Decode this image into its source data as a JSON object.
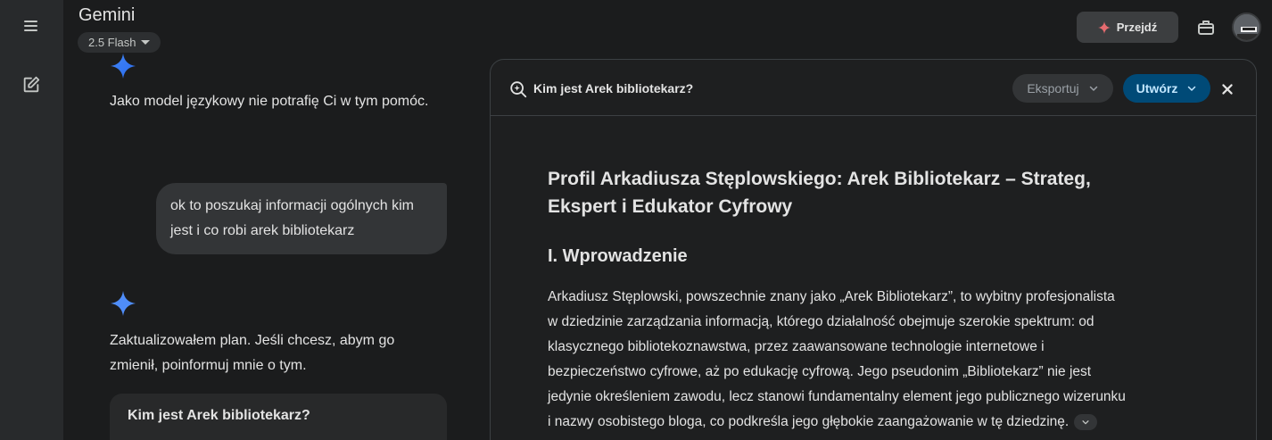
{
  "header": {
    "app_name": "Gemini",
    "model_label": "2.5 Flash",
    "go_button_label": "Przejdź"
  },
  "chat": {
    "model_reply_1": "Jako model językowy nie potrafię Ci w tym pomóc.",
    "user_message": "ok to poszukaj informacji ogólnych kim jest i co robi arek bibliotekarz",
    "model_reply_2": "Zaktualizowałem plan. Jeśli chcesz, abym go zmienił, poinformuj mnie o tym.",
    "plan_card_title": "Kim jest Arek bibliotekarz?"
  },
  "canvas": {
    "title": "Kim jest Arek bibliotekarz?",
    "export_label": "Eksportuj",
    "create_label": "Utwórz",
    "doc_heading": "Profil Arkadiusza Stęplowskiego: Arek Bibliotekarz – Strateg, Ekspert i Edukator Cyfrowy",
    "section_heading": "I. Wprowadzenie",
    "paragraph": "Arkadiusz Stęplowski, powszechnie znany jako „Arek Bibliotekarz”, to wybitny profesjonalista w dziedzinie zarządzania informacją, którego działalność obejmuje szerokie spektrum: od klasycznego bibliotekoznawstwa, przez zaawansowane technologie internetowe i bezpieczeństwo cyfrowe, aż po edukację cyfrową. Jego pseudonim „Bibliotekarz” nie jest jedynie określeniem zawodu, lecz stanowi fundamentalny element jego publicznego wizerunku i nazwy osobistego bloga, co podkreśla jego głębokie zaangażowanie w tę dziedzinę."
  },
  "colors": {
    "background": "#1b1c1d",
    "rail": "#282a2c",
    "create_button": "#004a77",
    "gemini_spark": "#4f8df9"
  },
  "icons": [
    "menu-icon",
    "new-chat-icon",
    "sparkle-icon",
    "toolbox-icon",
    "gemini-spark-icon",
    "deep-research-icon",
    "chevron-down-icon",
    "close-icon"
  ]
}
